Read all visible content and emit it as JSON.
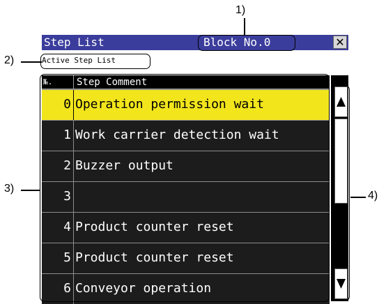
{
  "window": {
    "title": "Step List",
    "block_label": "Block No.0",
    "close_glyph": "✕"
  },
  "active_label": "Active Step List",
  "table": {
    "col_no": "№.",
    "col_comment": "Step Comment",
    "rows": [
      {
        "no": "0",
        "comment": "Operation permission wait",
        "selected": true
      },
      {
        "no": "1",
        "comment": "Work carrier detection wait",
        "selected": false
      },
      {
        "no": "2",
        "comment": "Buzzer output",
        "selected": false
      },
      {
        "no": "3",
        "comment": "",
        "selected": false
      },
      {
        "no": "4",
        "comment": "Product counter reset",
        "selected": false
      },
      {
        "no": "5",
        "comment": "Product counter reset",
        "selected": false
      },
      {
        "no": "6",
        "comment": "Conveyor operation",
        "selected": false
      }
    ]
  },
  "scrollbar": {
    "up_glyph": "▲",
    "down_glyph": "▼",
    "position_fraction": 0.58
  },
  "callouts": {
    "c1": "1)",
    "c2": "2)",
    "c3": "3)",
    "c4": "4)"
  },
  "colors": {
    "titlebar": "#3b3d9c",
    "selected_row": "#f2e51c",
    "row_bg": "#1c1c1c"
  }
}
